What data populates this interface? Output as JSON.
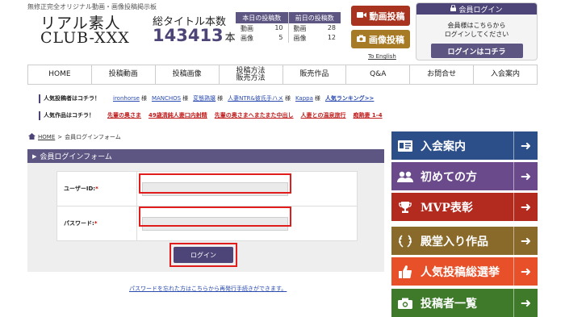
{
  "header": {
    "tagline": "無修正完全オリジナル動画・画像投稿掲示板",
    "logo_line1": "リアル素人",
    "logo_line2": "CLUB-XXX",
    "total_label": "総タイトル本数",
    "total_count": "143413",
    "total_unit": "本",
    "stats": {
      "today_label": "本日の投稿数",
      "yesterday_label": "前日の投稿数",
      "video_label": "動画",
      "image_label": "画像",
      "today_video": "10",
      "today_image": "5",
      "yesterday_video": "28",
      "yesterday_image": "12"
    },
    "video_post_label": "動画投稿",
    "image_post_label": "画像投稿",
    "english_link": "To English",
    "login_box": {
      "title": "会員ログイン",
      "message_line1": "会員様はこちらから",
      "message_line2": "ログインしてください",
      "button_label": "ログインはコチラ"
    }
  },
  "nav": {
    "items": [
      {
        "label": "HOME"
      },
      {
        "label": "投稿動画"
      },
      {
        "label": "投稿画像"
      },
      {
        "label": "投稿方法\n販売方法"
      },
      {
        "label": "販売作品"
      },
      {
        "label": "Q&A"
      },
      {
        "label": "お問合せ"
      },
      {
        "label": "入会案内"
      }
    ]
  },
  "rankings": {
    "posters_label": "人気投稿者はコチラ！",
    "posters": [
      {
        "name": "ironhorse",
        "suffix": "様"
      },
      {
        "name": "MANCHOS",
        "suffix": "様"
      },
      {
        "name": "変態熟嬢",
        "suffix": "様"
      },
      {
        "name": "人妻NTR&彼氏手ハメ",
        "suffix": "様"
      },
      {
        "name": "Kappa",
        "suffix": "様"
      }
    ],
    "posters_more": "人気ランキング>>",
    "works_label": "人気作品はコチラ！",
    "works": [
      {
        "title": "先輩の奥さま"
      },
      {
        "title": "49歳清純人妻口内射精"
      },
      {
        "title": "先輩の奥さまへまたまた中出し"
      },
      {
        "title": "人妻との温泉旅行"
      },
      {
        "title": "痴熟妻 1-4"
      }
    ]
  },
  "breadcrumb": {
    "home": "HOME",
    "separator": ">",
    "current": "会員ログインフォーム"
  },
  "form": {
    "title": "会員ログインフォーム",
    "user_id_label": "ユーザーID:",
    "password_label": "パスワード:",
    "required_mark": "*",
    "user_id_value": "",
    "password_value": "",
    "submit_label": "ログイン",
    "forgot_link": "パスワードを忘れた方はこちらから再発行手続きができます。"
  },
  "sidebar": {
    "items": [
      {
        "label": "入会案内",
        "icon": "id-card-icon",
        "color": "#2c4f8a"
      },
      {
        "label": "初めての方",
        "icon": "people-icon",
        "color": "#6b4a8c"
      },
      {
        "label": "MVP表彰",
        "icon": "trophy-icon",
        "color": "#b32a1f"
      },
      {
        "label": "殿堂入り作品",
        "icon": "laurel-icon",
        "color": "#8a6a2a"
      },
      {
        "label": "人気投稿総選挙",
        "icon": "thumbs-up-icon",
        "color": "#e8502a"
      },
      {
        "label": "投稿者一覧",
        "icon": "camera-icon",
        "color": "#3f7a2a"
      }
    ]
  },
  "colors": {
    "brand_purple": "#4d4478",
    "highlight_red": "#e01c1c"
  }
}
